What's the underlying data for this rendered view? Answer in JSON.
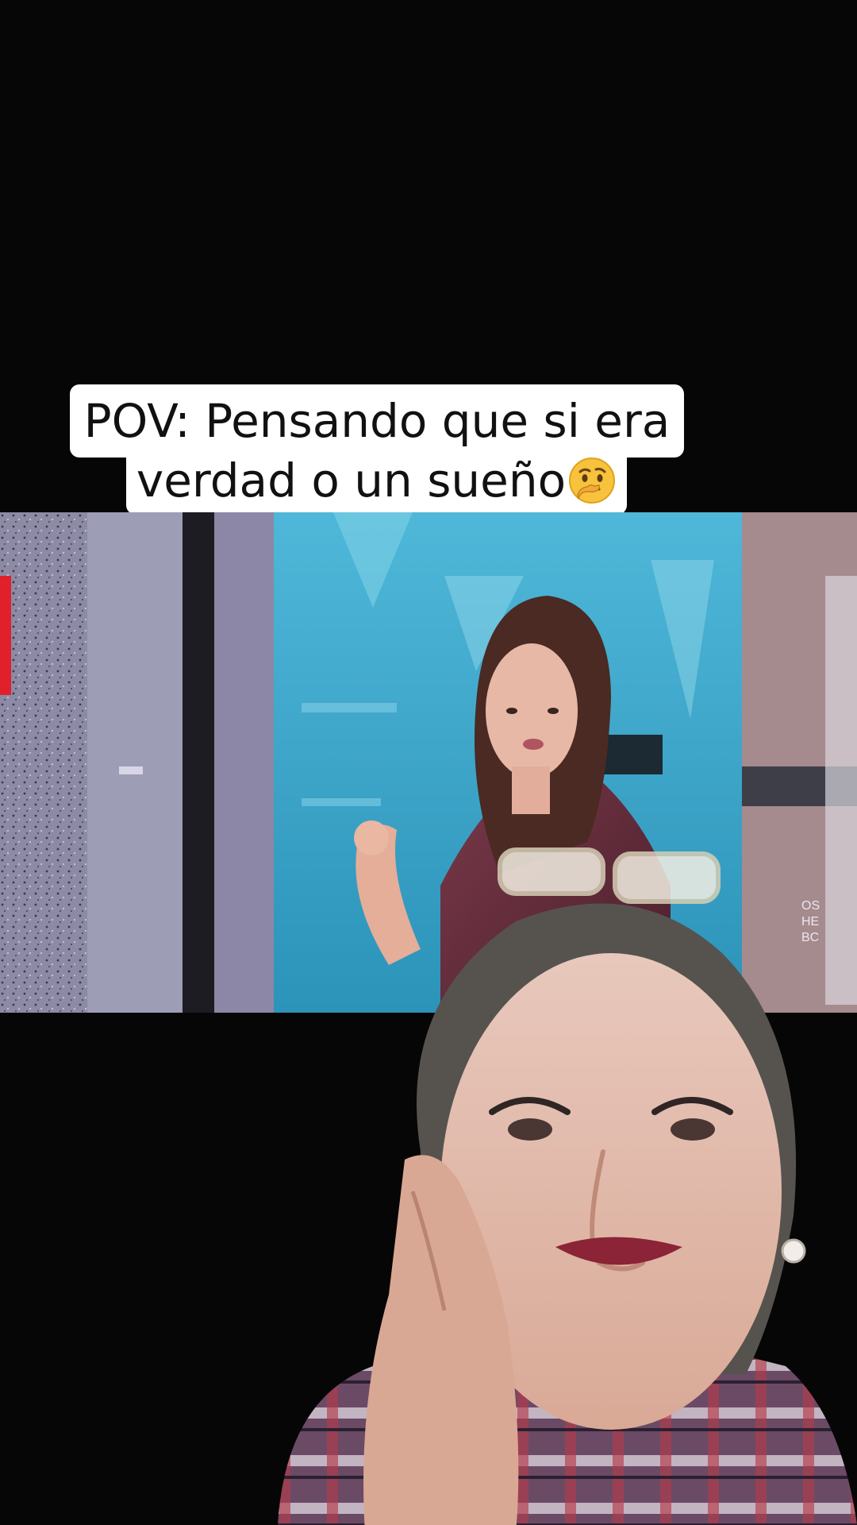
{
  "caption": {
    "line1": "POV: Pensando que si era",
    "line2": "verdad o un sueño",
    "emoji": "thinking-face-icon"
  },
  "tv_screen": {
    "side_text": [
      "OS",
      "HE",
      "BC"
    ]
  },
  "colors": {
    "background": "#060606",
    "caption_bg": "#ffffff",
    "caption_text": "#111111",
    "studio_blue": "#3aa7c8",
    "dress": "#6a2f3d"
  }
}
